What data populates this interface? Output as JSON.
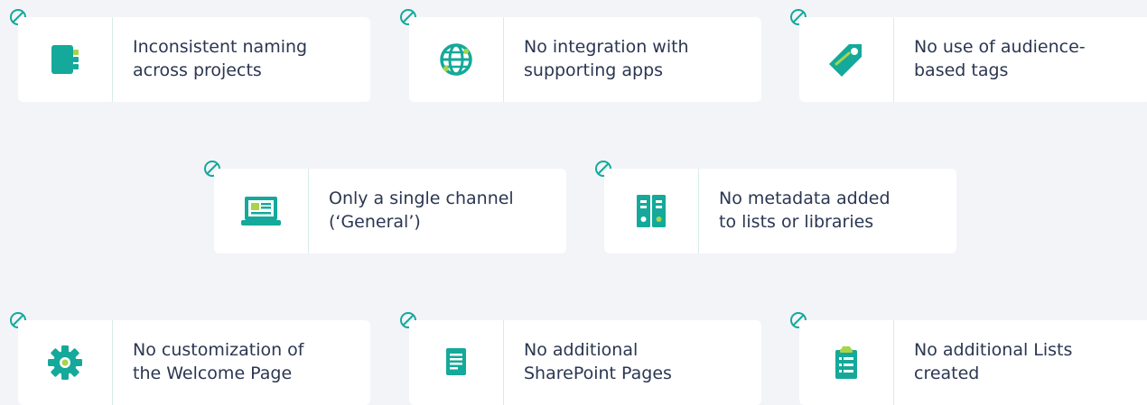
{
  "colors": {
    "background": "#f3f4f8",
    "card": "#ffffff",
    "text": "#2b3651",
    "teal": "#14a99a",
    "lime": "#a8d44a",
    "divider": "#d7ece8"
  },
  "cards": [
    {
      "label": "Inconsistent naming\nacross projects",
      "icon": "notebook-icon",
      "status_icon": "prohibited-icon"
    },
    {
      "label": "No integration with\nsupporting apps",
      "icon": "globe-icon",
      "status_icon": "prohibited-icon"
    },
    {
      "label": "No use of audience-\nbased tags",
      "icon": "tag-icon",
      "status_icon": "prohibited-icon"
    },
    {
      "label": "Only a single channel\n(‘General’)",
      "icon": "laptop-icon",
      "status_icon": "prohibited-icon"
    },
    {
      "label": "No metadata added\nto lists or libraries",
      "icon": "binders-icon",
      "status_icon": "prohibited-icon"
    },
    {
      "label": "No customization of\nthe Welcome Page",
      "icon": "gear-icon",
      "status_icon": "prohibited-icon"
    },
    {
      "label": "No additional\nSharePoint Pages",
      "icon": "document-icon",
      "status_icon": "prohibited-icon"
    },
    {
      "label": "No additional Lists\ncreated",
      "icon": "clipboard-icon",
      "status_icon": "prohibited-icon"
    }
  ]
}
